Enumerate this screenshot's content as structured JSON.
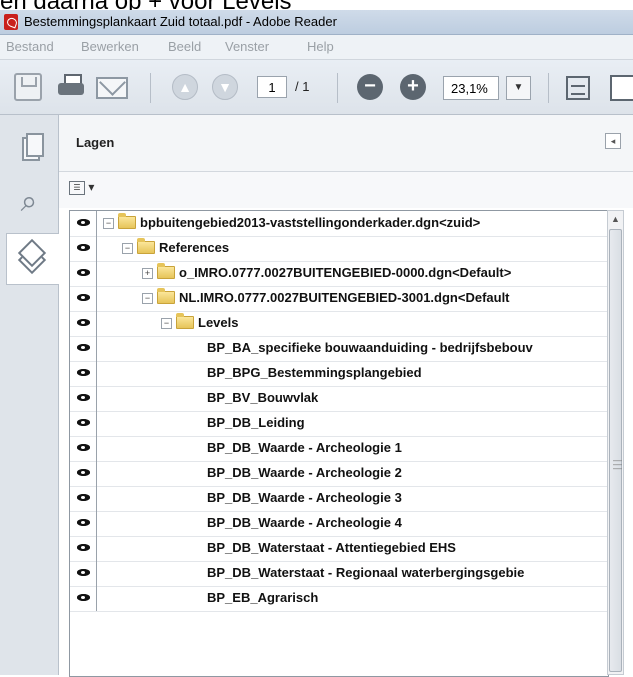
{
  "caption": "en daarna op + voor Levels",
  "window": {
    "title": "Bestemmingsplankaart Zuid totaal.pdf - Adobe Reader"
  },
  "menu": [
    "Bestand",
    "Bewerken",
    "Beeld",
    "Venster",
    "Help"
  ],
  "toolbar": {
    "page_current": "1",
    "page_total": "/ 1",
    "zoom": "23,1%"
  },
  "panel": {
    "title": "Lagen"
  },
  "tree": [
    {
      "label": "bpbuitengebied2013-vaststellingonderkader.dgn<zuid>",
      "expander": "−",
      "folder": true
    },
    {
      "label": "References",
      "expander": "−",
      "folder": true
    },
    {
      "label": "o_IMRO.0777.0027BUITENGEBIED-0000.dgn<Default>",
      "expander": "+",
      "folder": true
    },
    {
      "label": "NL.IMRO.0777.0027BUITENGEBIED-3001.dgn<Default",
      "expander": "−",
      "folder": true
    },
    {
      "label": "Levels",
      "expander": "−",
      "folder": true
    },
    {
      "label": "BP_BA_specifieke bouwaanduiding - bedrijfsbebouv"
    },
    {
      "label": "BP_BPG_Bestemmingsplangebied"
    },
    {
      "label": "BP_BV_Bouwvlak"
    },
    {
      "label": "BP_DB_Leiding"
    },
    {
      "label": "BP_DB_Waarde - Archeologie 1"
    },
    {
      "label": "BP_DB_Waarde - Archeologie 2"
    },
    {
      "label": "BP_DB_Waarde - Archeologie 3"
    },
    {
      "label": "BP_DB_Waarde - Archeologie 4"
    },
    {
      "label": "BP_DB_Waterstaat - Attentiegebied EHS"
    },
    {
      "label": "BP_DB_Waterstaat - Regionaal waterbergingsgebie"
    },
    {
      "label": "BP_EB_Agrarisch"
    }
  ]
}
